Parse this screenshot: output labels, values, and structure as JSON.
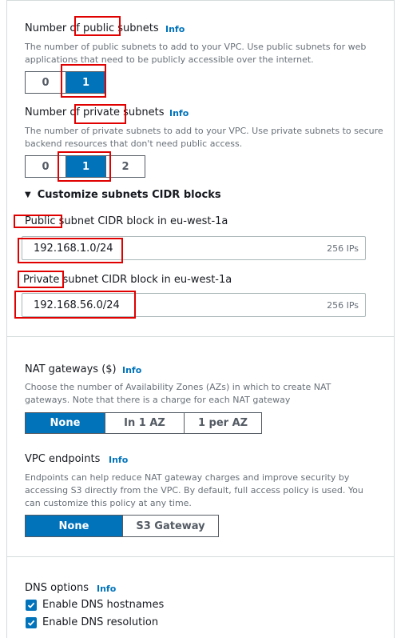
{
  "public_subnets": {
    "title": "Number of public subnets",
    "info": "Info",
    "description": "The number of public subnets to add to your VPC. Use public subnets for web applications that need to be publicly accessible over the internet.",
    "options": [
      "0",
      "1"
    ],
    "selected": "1"
  },
  "private_subnets": {
    "title": "Number of private subnets",
    "info": "Info",
    "description": "The number of private subnets to add to your VPC. Use private subnets to secure backend resources that don't need public access.",
    "options": [
      "0",
      "1",
      "2"
    ],
    "selected": "1"
  },
  "cidr_section": {
    "toggle_label": "Customize subnets CIDR blocks",
    "public_label": "Public subnet CIDR block in eu-west-1a",
    "public_value": "192.168.1.0/24",
    "public_suffix": "256 IPs",
    "private_label": "Private subnet CIDR block in eu-west-1a",
    "private_value": "192.168.56.0/24",
    "private_suffix": "256 IPs"
  },
  "nat": {
    "title": "NAT gateways ($)",
    "info": "Info",
    "description": "Choose the number of Availability Zones (AZs) in which to create NAT gateways. Note that there is a charge for each NAT gateway",
    "options": [
      "None",
      "In 1 AZ",
      "1 per AZ"
    ],
    "selected": "None"
  },
  "vpc_endpoints": {
    "title": "VPC endpoints",
    "info": "Info",
    "description": "Endpoints can help reduce NAT gateway charges and improve security by accessing S3 directly from the VPC. By default, full access policy is used. You can customize this policy at any time.",
    "options": [
      "None",
      "S3 Gateway"
    ],
    "selected": "None"
  },
  "dns": {
    "title": "DNS options",
    "info": "Info",
    "hostnames_label": "Enable DNS hostnames",
    "resolution_label": "Enable DNS resolution",
    "hostnames_checked": true,
    "resolution_checked": true
  },
  "colors": {
    "accent": "#0073bb",
    "highlight": "#e00000",
    "text": "#16191f",
    "muted": "#687078"
  }
}
